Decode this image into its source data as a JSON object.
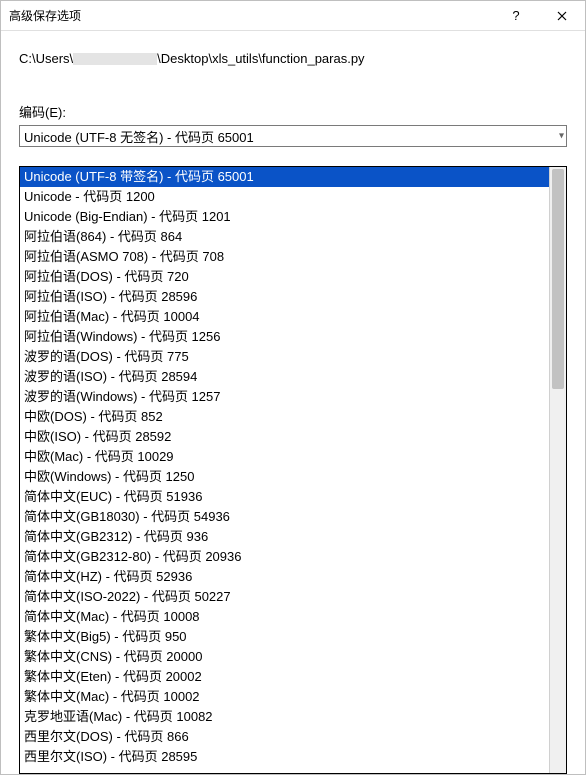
{
  "titlebar": {
    "title": "高级保存选项"
  },
  "path": {
    "prefix": "C:\\Users\\",
    "suffix": "\\Desktop\\xls_utils\\function_paras.py"
  },
  "encoding": {
    "label": "编码(E):",
    "selected": "Unicode (UTF-8 无签名) - 代码页 65001",
    "items": [
      {
        "label": "Unicode (UTF-8 带签名) - 代码页 65001",
        "selected": true
      },
      {
        "label": "Unicode - 代码页 1200"
      },
      {
        "label": "Unicode (Big-Endian) - 代码页 1201"
      },
      {
        "label": "阿拉伯语(864) - 代码页 864"
      },
      {
        "label": "阿拉伯语(ASMO 708) - 代码页 708"
      },
      {
        "label": "阿拉伯语(DOS) - 代码页 720"
      },
      {
        "label": "阿拉伯语(ISO) - 代码页 28596"
      },
      {
        "label": "阿拉伯语(Mac) - 代码页 10004"
      },
      {
        "label": "阿拉伯语(Windows) - 代码页 1256"
      },
      {
        "label": "波罗的语(DOS) - 代码页 775"
      },
      {
        "label": "波罗的语(ISO) - 代码页 28594"
      },
      {
        "label": "波罗的语(Windows) - 代码页 1257"
      },
      {
        "label": "中欧(DOS) - 代码页 852"
      },
      {
        "label": "中欧(ISO) - 代码页 28592"
      },
      {
        "label": "中欧(Mac) - 代码页 10029"
      },
      {
        "label": "中欧(Windows) - 代码页 1250"
      },
      {
        "label": "简体中文(EUC) - 代码页 51936"
      },
      {
        "label": "简体中文(GB18030) - 代码页 54936"
      },
      {
        "label": "简体中文(GB2312) - 代码页 936"
      },
      {
        "label": "简体中文(GB2312-80) - 代码页 20936"
      },
      {
        "label": "简体中文(HZ) - 代码页 52936"
      },
      {
        "label": "简体中文(ISO-2022) - 代码页 50227"
      },
      {
        "label": "简体中文(Mac) - 代码页 10008"
      },
      {
        "label": "繁体中文(Big5) - 代码页 950"
      },
      {
        "label": "繁体中文(CNS) - 代码页 20000"
      },
      {
        "label": "繁体中文(Eten) - 代码页 20002"
      },
      {
        "label": "繁体中文(Mac) - 代码页 10002"
      },
      {
        "label": "克罗地亚语(Mac) - 代码页 10082"
      },
      {
        "label": "西里尔文(DOS) - 代码页 866"
      },
      {
        "label": "西里尔文(ISO) - 代码页 28595"
      }
    ]
  }
}
